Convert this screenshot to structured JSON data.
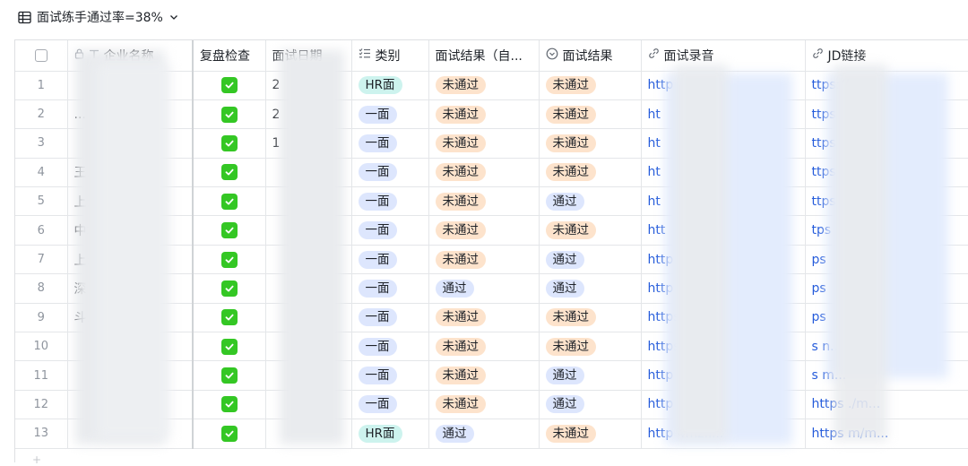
{
  "view": {
    "title": "面试练手通过率=38%"
  },
  "columns": {
    "company": "企业名称",
    "review": "复盘检查",
    "date": "面试日期",
    "category": "类别",
    "result_auto": "面试结果（自...",
    "result": "面试结果",
    "recording": "面试录音",
    "jd": "JD链接"
  },
  "rows": [
    {
      "idx": "1",
      "company": "",
      "date": "2",
      "category": "HR面",
      "category_color": "teal",
      "result_auto": "未通过",
      "result_auto_color": "orange",
      "result": "未通过",
      "result_color": "orange",
      "recording": "http",
      "jd": "ttps://"
    },
    {
      "idx": "2",
      "company": "...",
      "date": "2",
      "category": "一面",
      "category_color": "blue",
      "result_auto": "未通过",
      "result_auto_color": "orange",
      "result": "未通过",
      "result_color": "orange",
      "recording": "ht",
      "jd": "ttps"
    },
    {
      "idx": "3",
      "company": "",
      "date": "1",
      "category": "一面",
      "category_color": "blue",
      "result_auto": "未通过",
      "result_auto_color": "orange",
      "result": "未通过",
      "result_color": "orange",
      "recording": "ht",
      "jd": "ttps"
    },
    {
      "idx": "4",
      "company": "王...",
      "date": "",
      "category": "一面",
      "category_color": "blue",
      "result_auto": "未通过",
      "result_auto_color": "orange",
      "result": "未通过",
      "result_color": "orange",
      "recording": "ht",
      "jd": "ttps"
    },
    {
      "idx": "5",
      "company": "上海        艮...",
      "date": "",
      "category": "一面",
      "category_color": "blue",
      "result_auto": "未通过",
      "result_auto_color": "orange",
      "result": "通过",
      "result_color": "blue",
      "recording": "ht",
      "jd": "ttps"
    },
    {
      "idx": "6",
      "company": "中君",
      "date": "",
      "category": "一面",
      "category_color": "blue",
      "result_auto": "未通过",
      "result_auto_color": "orange",
      "result": "未通过",
      "result_color": "orange",
      "recording": "htt",
      "jd": "tps"
    },
    {
      "idx": "7",
      "company": "上海        ...",
      "date": "",
      "category": "一面",
      "category_color": "blue",
      "result_auto": "未通过",
      "result_auto_color": "orange",
      "result": "通过",
      "result_color": "blue",
      "recording": "http",
      "jd": "ps"
    },
    {
      "idx": "8",
      "company": "深         ...",
      "date": "",
      "category": "一面",
      "category_color": "blue",
      "result_auto": "通过",
      "result_auto_color": "blue",
      "result": "通过",
      "result_color": "blue",
      "recording": "http",
      "jd": "ps"
    },
    {
      "idx": "9",
      "company": "          斗...",
      "date": "",
      "category": "一面",
      "category_color": "blue",
      "result_auto": "未通过",
      "result_auto_color": "orange",
      "result": "未通过",
      "result_color": "orange",
      "recording": "https",
      "jd": "ps"
    },
    {
      "idx": "10",
      "company": "",
      "date": "",
      "category": "一面",
      "category_color": "blue",
      "result_auto": "未通过",
      "result_auto_color": "orange",
      "result": "未通过",
      "result_color": "orange",
      "recording": "https",
      "jd": "s                       n..."
    },
    {
      "idx": "11",
      "company": "",
      "date": "",
      "category": "一面",
      "category_color": "blue",
      "result_auto": "未通过",
      "result_auto_color": "orange",
      "result": "通过",
      "result_color": "blue",
      "recording": "http",
      "jd": "s                       m..."
    },
    {
      "idx": "12",
      "company": "",
      "date": "",
      "category": "一面",
      "category_color": "blue",
      "result_auto": "未通过",
      "result_auto_color": "orange",
      "result": "通过",
      "result_color": "blue",
      "recording": "http                    4mz.r...",
      "jd": "https                 ./m..."
    },
    {
      "idx": "13",
      "company": "",
      "date": "",
      "category": "HR面",
      "category_color": "teal",
      "result_auto": "通过",
      "result_auto_color": "blue",
      "result": "未通过",
      "result_color": "orange",
      "recording": "http                    4mz.f...",
      "jd": "https                 m/m..."
    }
  ],
  "colors": {
    "check_green": "#34c724",
    "link_blue": "#245bdb",
    "tag_teal": "#cdf3ee",
    "tag_blue": "#dde6fd",
    "tag_orange": "#fde3cc"
  }
}
